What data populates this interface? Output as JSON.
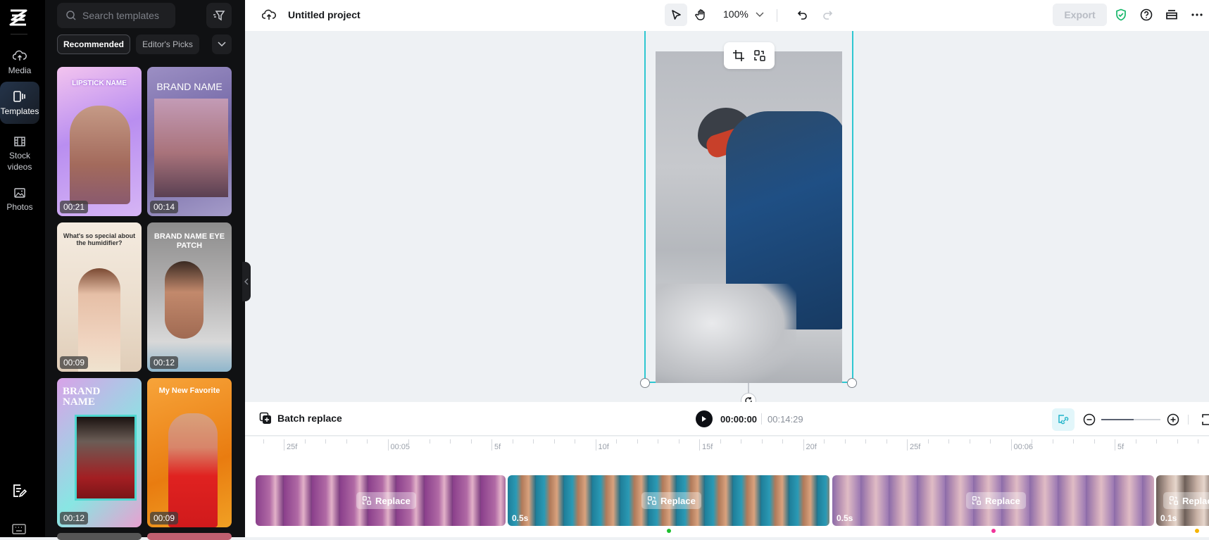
{
  "rail": {
    "items": [
      {
        "label": "Media",
        "icon": "cloud-upload-icon"
      },
      {
        "label": "Templates",
        "icon": "templates-icon",
        "active": true
      },
      {
        "label": "Stock videos",
        "icon": "film-icon"
      },
      {
        "label": "Photos",
        "icon": "image-icon"
      }
    ]
  },
  "panel": {
    "search_placeholder": "Search templates",
    "chips": [
      "Recommended",
      "Editor's Picks"
    ],
    "templates": [
      {
        "title": "LIPSTICK NAME",
        "duration": "00:21"
      },
      {
        "title": "BRAND NAME",
        "duration": "00:14"
      },
      {
        "title": "What's so special about the humidifier?",
        "duration": "00:09"
      },
      {
        "title": "BRAND NAME EYE PATCH",
        "duration": "00:12"
      },
      {
        "title": "BRAND NAME",
        "duration": "00:12"
      },
      {
        "title": "My New Favorite",
        "duration": "00:09"
      }
    ]
  },
  "topbar": {
    "project_title": "Untitled project",
    "zoom": "100%",
    "export_label": "Export"
  },
  "controls": {
    "batch_replace_label": "Batch replace",
    "current_time": "00:00:00",
    "total_time": "00:14:29",
    "zoom_level": 0.55
  },
  "ruler": {
    "labels": [
      "25f",
      "00:05",
      "5f",
      "10f",
      "15f",
      "20f",
      "25f",
      "00:06",
      "5f"
    ]
  },
  "timeline": {
    "replace_label": "Replace",
    "clips": [
      {
        "duration": ""
      },
      {
        "duration": "0.5s"
      },
      {
        "duration": "0.5s"
      },
      {
        "duration": "0.1s",
        "replace_label": "Replac"
      }
    ]
  },
  "colors": {
    "accent": "#2ec7d1",
    "marker_green": "#1dbf2e",
    "marker_pink": "#f0359a",
    "marker_yellow": "#f5b400",
    "shield_green": "#18b86b"
  }
}
